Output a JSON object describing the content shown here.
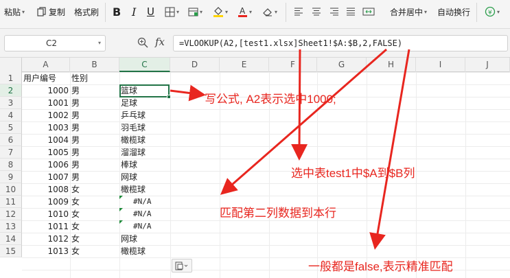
{
  "ribbon": {
    "paste_label": "粘贴",
    "copy_label": "复制",
    "format_painter_label": "格式刷",
    "merge_center_label": "合并居中",
    "wrap_text_label": "自动换行"
  },
  "formula_bar": {
    "name_box": "C2",
    "fx_label": "fx",
    "formula": "=VLOOKUP(A2,[test1.xlsx]Sheet1!$A:$B,2,FALSE)"
  },
  "sheet": {
    "columns": [
      "A",
      "B",
      "C",
      "D",
      "E",
      "F",
      "G",
      "H",
      "I",
      "J"
    ],
    "active_column": "C",
    "active_row": 2,
    "rows": [
      {
        "n": "1",
        "a": "用户编号",
        "b": "性别",
        "c": ""
      },
      {
        "n": "2",
        "a": "1000",
        "b": "男",
        "c": "篮球"
      },
      {
        "n": "3",
        "a": "1001",
        "b": "男",
        "c": "足球"
      },
      {
        "n": "4",
        "a": "1002",
        "b": "男",
        "c": "乒乓球"
      },
      {
        "n": "5",
        "a": "1003",
        "b": "男",
        "c": "羽毛球"
      },
      {
        "n": "6",
        "a": "1004",
        "b": "男",
        "c": "橄榄球"
      },
      {
        "n": "7",
        "a": "1005",
        "b": "男",
        "c": "溜溜球"
      },
      {
        "n": "8",
        "a": "1006",
        "b": "男",
        "c": "棒球"
      },
      {
        "n": "9",
        "a": "1007",
        "b": "男",
        "c": "网球"
      },
      {
        "n": "10",
        "a": "1008",
        "b": "女",
        "c": "橄榄球"
      },
      {
        "n": "11",
        "a": "1009",
        "b": "女",
        "c": "#N/A"
      },
      {
        "n": "12",
        "a": "1010",
        "b": "女",
        "c": "#N/A"
      },
      {
        "n": "13",
        "a": "1011",
        "b": "女",
        "c": "#N/A"
      },
      {
        "n": "14",
        "a": "1012",
        "b": "女",
        "c": "网球"
      },
      {
        "n": "15",
        "a": "1013",
        "b": "女",
        "c": "橄榄球"
      }
    ]
  },
  "annotations": {
    "note1": "写公式, A2表示选中1000;",
    "note2": "选中表test1中$A到$B列",
    "note3": "匹配第二列数据到本行",
    "note4": "一般都是false,表示精准匹配",
    "color": "#e8261f"
  },
  "colors": {
    "accent": "#217346",
    "annotation": "#e8261f"
  }
}
